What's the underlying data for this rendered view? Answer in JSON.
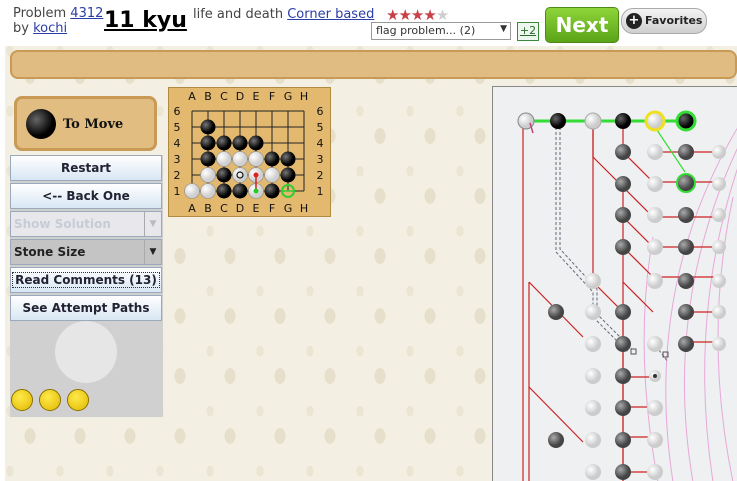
{
  "header": {
    "problem_prefix": "Problem",
    "problem_number": "4312",
    "by_prefix": "by",
    "author": "kochi",
    "rank": "11 kyu",
    "category": "life and death",
    "subcategory": "Corner based",
    "stars_filled": 4,
    "stars_total": 5,
    "flag_select_value": "flag problem... (2)",
    "vote_label": "+2",
    "next_label": "Next",
    "favorites_label": "Favorites",
    "favorites_icon_glyph": "+"
  },
  "to_move": {
    "label": "To Move",
    "color": "black"
  },
  "controls": {
    "restart": "Restart",
    "back_one": "<-- Back One",
    "show_solution": "Show Solution",
    "stone_size": "Stone Size",
    "read_comments": "Read Comments (13)",
    "attempt_paths": "See Attempt Paths"
  },
  "board": {
    "columns": [
      "A",
      "B",
      "C",
      "D",
      "E",
      "F",
      "G",
      "H"
    ],
    "rows": [
      "6",
      "5",
      "4",
      "3",
      "2",
      "1"
    ],
    "black_stones": [
      "B5",
      "B4",
      "C4",
      "D4",
      "E4",
      "B3",
      "F3",
      "G3",
      "C2",
      "G2",
      "C1",
      "D1",
      "F1"
    ],
    "white_stones": [
      "C3",
      "D3",
      "E3",
      "B2",
      "E2",
      "F2",
      "A1",
      "B1",
      "E1"
    ],
    "marks": {
      "last_move_circle": "D2",
      "green_ring": "G1",
      "red_dot": "E2",
      "green_dot": "E1"
    }
  },
  "colors": {
    "accent_green": "#6dbf2a",
    "wood": "#e0bc83",
    "tree_red": "#cc2222",
    "tree_pink": "#e8a8d8",
    "highlight_green": "#33dd33"
  }
}
